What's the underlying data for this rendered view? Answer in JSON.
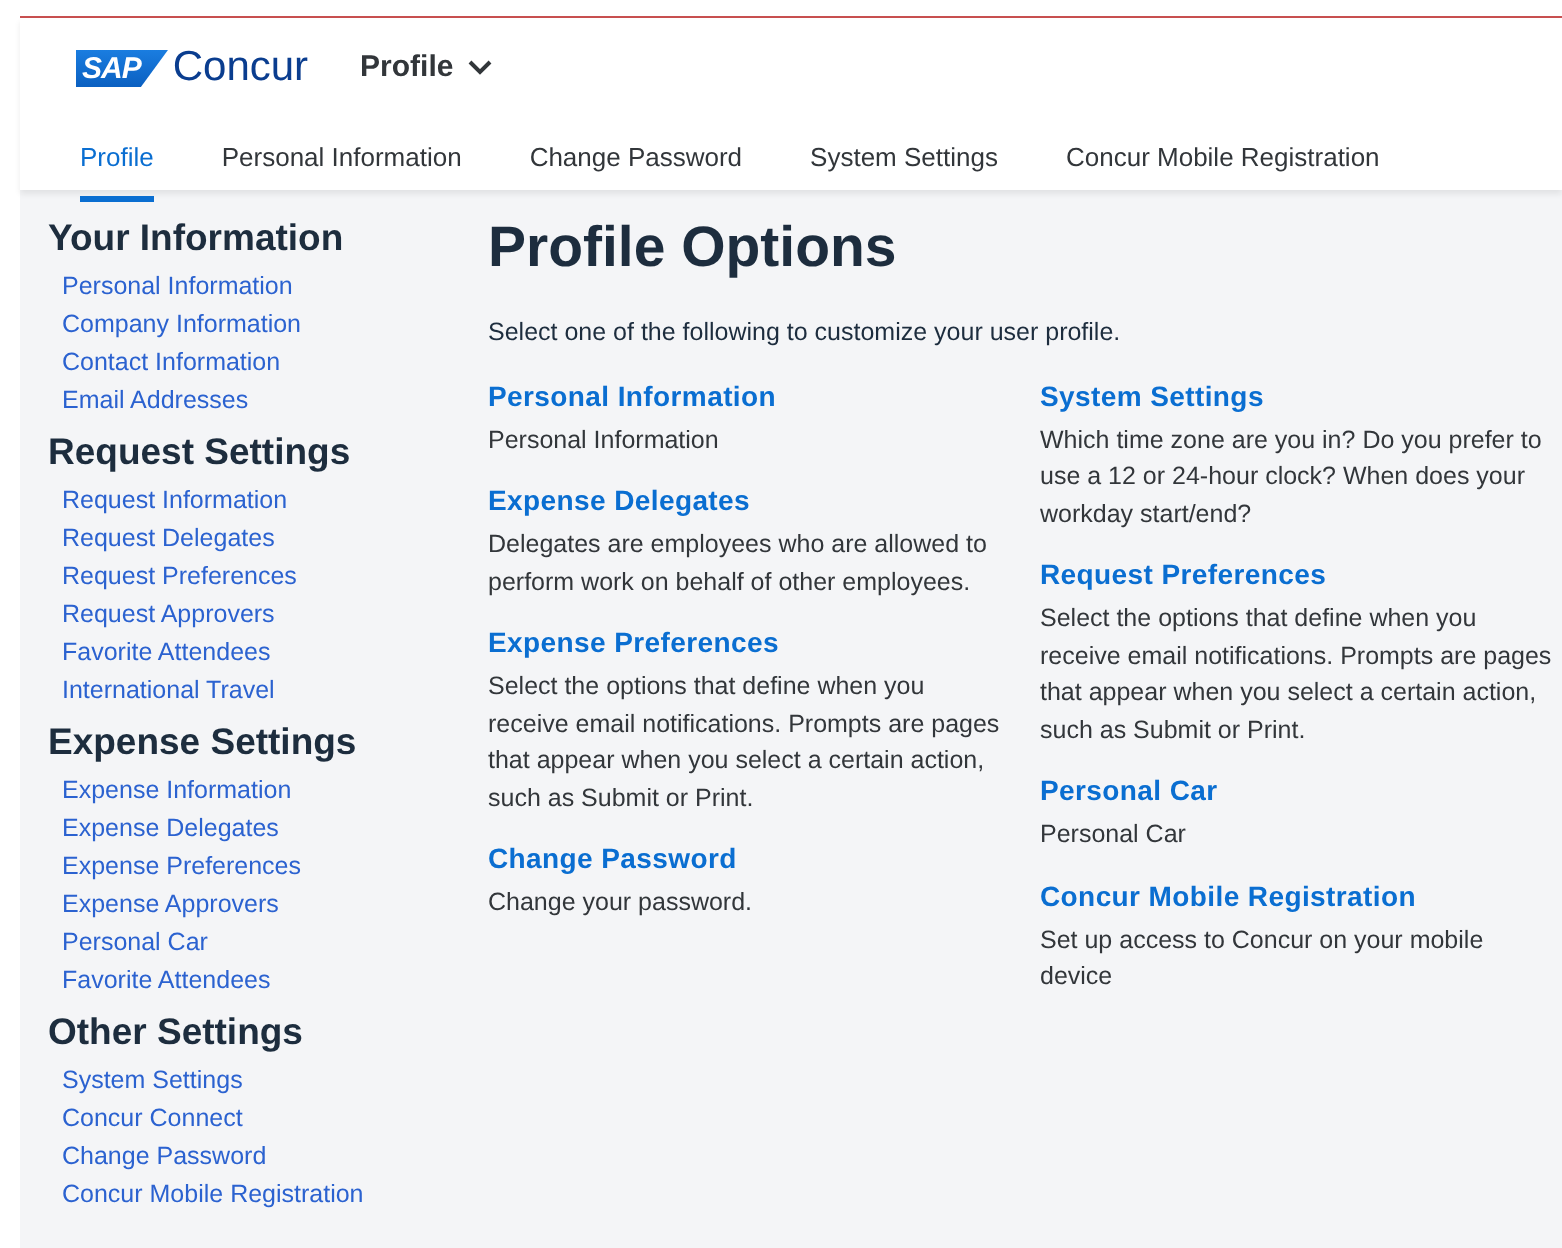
{
  "header": {
    "logo_mark": "SAP",
    "logo_name": "Concur",
    "menu": "Profile"
  },
  "tabs": [
    {
      "label": "Profile",
      "selected": true
    },
    {
      "label": "Personal Information",
      "selected": false
    },
    {
      "label": "Change Password",
      "selected": false
    },
    {
      "label": "System Settings",
      "selected": false
    },
    {
      "label": "Concur Mobile Registration",
      "selected": false
    }
  ],
  "sidebar": [
    {
      "heading": "Your Information",
      "links": [
        "Personal Information",
        "Company Information",
        "Contact Information",
        "Email Addresses"
      ]
    },
    {
      "heading": "Request Settings",
      "links": [
        "Request Information",
        "Request Delegates",
        "Request Preferences",
        "Request Approvers",
        "Favorite Attendees",
        "International Travel"
      ]
    },
    {
      "heading": "Expense Settings",
      "links": [
        "Expense Information",
        "Expense Delegates",
        "Expense Preferences",
        "Expense Approvers",
        "Personal Car",
        "Favorite Attendees"
      ]
    },
    {
      "heading": "Other Settings",
      "links": [
        "System Settings",
        "Concur Connect",
        "Change Password",
        "Concur Mobile Registration"
      ]
    }
  ],
  "main": {
    "title": "Profile Options",
    "intro": "Select one of the following to customize your user profile.",
    "columns": [
      [
        {
          "title": "Personal Information",
          "description": "Personal Information"
        },
        {
          "title": "Expense Delegates",
          "description": "Delegates are employees who are allowed to perform work on behalf of other employees."
        },
        {
          "title": "Expense Preferences",
          "description": "Select the options that define when you receive email notifications. Prompts are pages that appear when you select a certain action, such as Submit or Print."
        },
        {
          "title": "Change Password",
          "description": "Change your password."
        }
      ],
      [
        {
          "title": "System Settings",
          "description": "Which time zone are you in? Do you prefer to use a 12 or 24-hour clock? When does your workday start/end?"
        },
        {
          "title": "Request Preferences",
          "description": "Select the options that define when you receive email notifications. Prompts are pages that appear when you select a certain action, such as Submit or Print."
        },
        {
          "title": "Personal Car",
          "description": "Personal Car"
        },
        {
          "title": "Concur Mobile Registration",
          "description": "Set up access to Concur on your mobile device"
        }
      ]
    ]
  }
}
